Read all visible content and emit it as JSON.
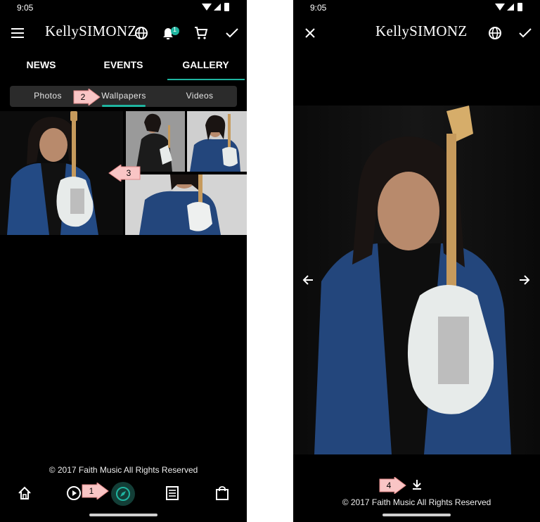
{
  "left_screen": {
    "status_time": "9:05",
    "logo_text": "KellySIMONZ",
    "tabs": [
      "NEWS",
      "EVENTS",
      "GALLERY"
    ],
    "subtabs": [
      "Photos",
      "Wallpapers",
      "Videos"
    ],
    "footer_text": "© 2017 Faith Music All Rights Reserved",
    "notification_badge": "1",
    "bottom_nav": [
      "home-icon",
      "play-circle-icon",
      "compass-icon",
      "list-icon",
      "shopping-bag-icon"
    ]
  },
  "right_screen": {
    "status_time": "9:05",
    "logo_text": "KellySIMONZ",
    "footer_text": "© 2017 Faith Music All Rights Reserved"
  },
  "callouts": [
    "1",
    "2",
    "3",
    "4"
  ],
  "colors": {
    "accent": "#1fb5a0",
    "callout_fill": "#f9c5c5",
    "callout_border": "#e58a8a",
    "background": "#000000"
  }
}
